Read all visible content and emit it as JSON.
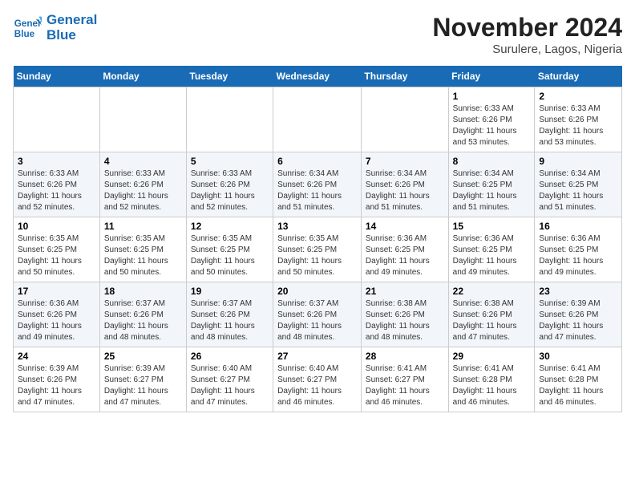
{
  "header": {
    "logo_line1": "General",
    "logo_line2": "Blue",
    "month": "November 2024",
    "location": "Surulere, Lagos, Nigeria"
  },
  "weekdays": [
    "Sunday",
    "Monday",
    "Tuesday",
    "Wednesday",
    "Thursday",
    "Friday",
    "Saturday"
  ],
  "weeks": [
    [
      {
        "day": "",
        "info": ""
      },
      {
        "day": "",
        "info": ""
      },
      {
        "day": "",
        "info": ""
      },
      {
        "day": "",
        "info": ""
      },
      {
        "day": "",
        "info": ""
      },
      {
        "day": "1",
        "info": "Sunrise: 6:33 AM\nSunset: 6:26 PM\nDaylight: 11 hours and 53 minutes."
      },
      {
        "day": "2",
        "info": "Sunrise: 6:33 AM\nSunset: 6:26 PM\nDaylight: 11 hours and 53 minutes."
      }
    ],
    [
      {
        "day": "3",
        "info": "Sunrise: 6:33 AM\nSunset: 6:26 PM\nDaylight: 11 hours and 52 minutes."
      },
      {
        "day": "4",
        "info": "Sunrise: 6:33 AM\nSunset: 6:26 PM\nDaylight: 11 hours and 52 minutes."
      },
      {
        "day": "5",
        "info": "Sunrise: 6:33 AM\nSunset: 6:26 PM\nDaylight: 11 hours and 52 minutes."
      },
      {
        "day": "6",
        "info": "Sunrise: 6:34 AM\nSunset: 6:26 PM\nDaylight: 11 hours and 51 minutes."
      },
      {
        "day": "7",
        "info": "Sunrise: 6:34 AM\nSunset: 6:26 PM\nDaylight: 11 hours and 51 minutes."
      },
      {
        "day": "8",
        "info": "Sunrise: 6:34 AM\nSunset: 6:25 PM\nDaylight: 11 hours and 51 minutes."
      },
      {
        "day": "9",
        "info": "Sunrise: 6:34 AM\nSunset: 6:25 PM\nDaylight: 11 hours and 51 minutes."
      }
    ],
    [
      {
        "day": "10",
        "info": "Sunrise: 6:35 AM\nSunset: 6:25 PM\nDaylight: 11 hours and 50 minutes."
      },
      {
        "day": "11",
        "info": "Sunrise: 6:35 AM\nSunset: 6:25 PM\nDaylight: 11 hours and 50 minutes."
      },
      {
        "day": "12",
        "info": "Sunrise: 6:35 AM\nSunset: 6:25 PM\nDaylight: 11 hours and 50 minutes."
      },
      {
        "day": "13",
        "info": "Sunrise: 6:35 AM\nSunset: 6:25 PM\nDaylight: 11 hours and 50 minutes."
      },
      {
        "day": "14",
        "info": "Sunrise: 6:36 AM\nSunset: 6:25 PM\nDaylight: 11 hours and 49 minutes."
      },
      {
        "day": "15",
        "info": "Sunrise: 6:36 AM\nSunset: 6:25 PM\nDaylight: 11 hours and 49 minutes."
      },
      {
        "day": "16",
        "info": "Sunrise: 6:36 AM\nSunset: 6:25 PM\nDaylight: 11 hours and 49 minutes."
      }
    ],
    [
      {
        "day": "17",
        "info": "Sunrise: 6:36 AM\nSunset: 6:26 PM\nDaylight: 11 hours and 49 minutes."
      },
      {
        "day": "18",
        "info": "Sunrise: 6:37 AM\nSunset: 6:26 PM\nDaylight: 11 hours and 48 minutes."
      },
      {
        "day": "19",
        "info": "Sunrise: 6:37 AM\nSunset: 6:26 PM\nDaylight: 11 hours and 48 minutes."
      },
      {
        "day": "20",
        "info": "Sunrise: 6:37 AM\nSunset: 6:26 PM\nDaylight: 11 hours and 48 minutes."
      },
      {
        "day": "21",
        "info": "Sunrise: 6:38 AM\nSunset: 6:26 PM\nDaylight: 11 hours and 48 minutes."
      },
      {
        "day": "22",
        "info": "Sunrise: 6:38 AM\nSunset: 6:26 PM\nDaylight: 11 hours and 47 minutes."
      },
      {
        "day": "23",
        "info": "Sunrise: 6:39 AM\nSunset: 6:26 PM\nDaylight: 11 hours and 47 minutes."
      }
    ],
    [
      {
        "day": "24",
        "info": "Sunrise: 6:39 AM\nSunset: 6:26 PM\nDaylight: 11 hours and 47 minutes."
      },
      {
        "day": "25",
        "info": "Sunrise: 6:39 AM\nSunset: 6:27 PM\nDaylight: 11 hours and 47 minutes."
      },
      {
        "day": "26",
        "info": "Sunrise: 6:40 AM\nSunset: 6:27 PM\nDaylight: 11 hours and 47 minutes."
      },
      {
        "day": "27",
        "info": "Sunrise: 6:40 AM\nSunset: 6:27 PM\nDaylight: 11 hours and 46 minutes."
      },
      {
        "day": "28",
        "info": "Sunrise: 6:41 AM\nSunset: 6:27 PM\nDaylight: 11 hours and 46 minutes."
      },
      {
        "day": "29",
        "info": "Sunrise: 6:41 AM\nSunset: 6:28 PM\nDaylight: 11 hours and 46 minutes."
      },
      {
        "day": "30",
        "info": "Sunrise: 6:41 AM\nSunset: 6:28 PM\nDaylight: 11 hours and 46 minutes."
      }
    ]
  ]
}
